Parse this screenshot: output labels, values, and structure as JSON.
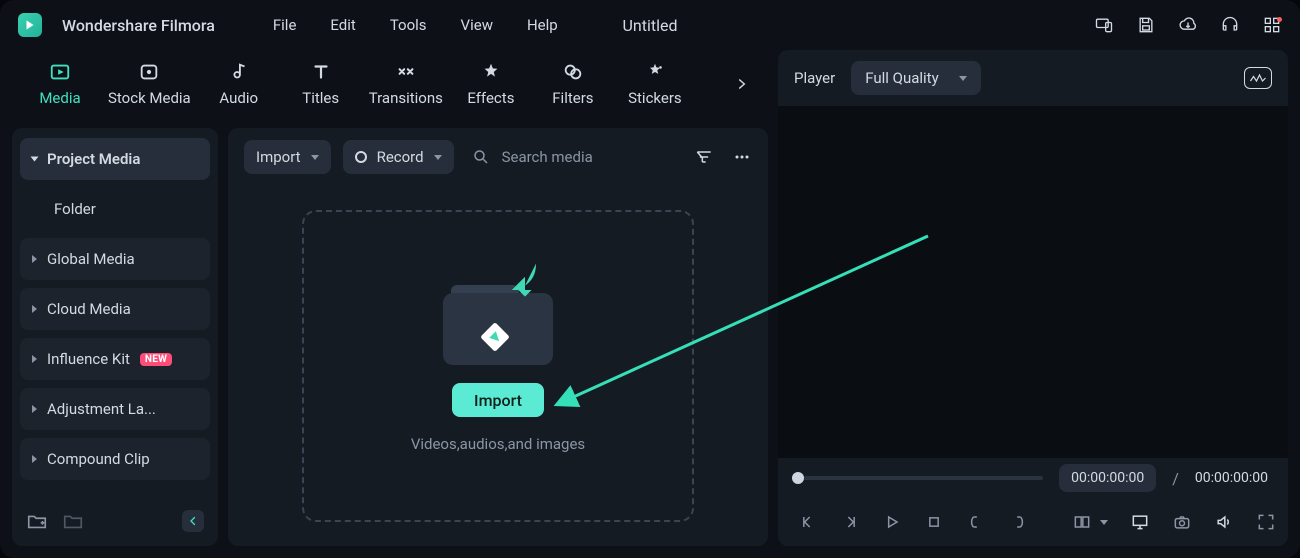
{
  "app": {
    "name": "Wondershare Filmora",
    "title": "Untitled"
  },
  "menus": {
    "file": "File",
    "edit": "Edit",
    "tools": "Tools",
    "view": "View",
    "help": "Help"
  },
  "tabs": {
    "media": "Media",
    "stock": "Stock Media",
    "audio": "Audio",
    "titles": "Titles",
    "transitions": "Transitions",
    "effects": "Effects",
    "filters": "Filters",
    "stickers": "Stickers"
  },
  "sidebar": {
    "project": "Project Media",
    "folder": "Folder",
    "global": "Global Media",
    "cloud": "Cloud Media",
    "influence": "Influence Kit",
    "influence_badge": "NEW",
    "adjustment": "Adjustment La...",
    "compound": "Compound Clip"
  },
  "toolbar": {
    "import": "Import",
    "record": "Record",
    "search_placeholder": "Search media"
  },
  "drop": {
    "button": "Import",
    "caption": "Videos,audios,and images"
  },
  "preview": {
    "label": "Player",
    "quality": "Full Quality",
    "tc_current": "00:00:00:00",
    "tc_total": "00:00:00:00"
  }
}
